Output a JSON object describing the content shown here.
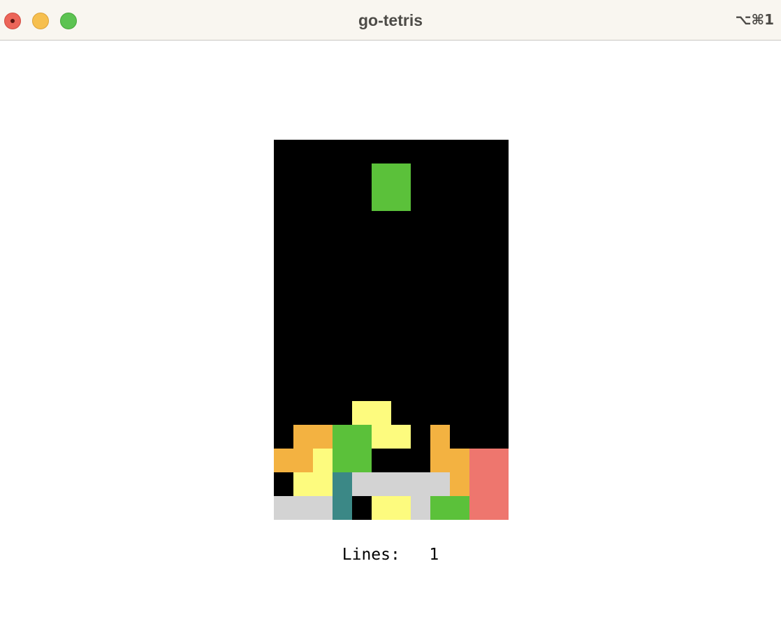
{
  "window": {
    "title": "go-tetris",
    "shortcut": "⌥⌘1"
  },
  "status": {
    "lines_label": "Lines:",
    "lines_value": "1"
  },
  "game": {
    "columns": 12,
    "rows": 16,
    "colors": {
      "G": "#5bc13a",
      "O": "#f3b241",
      "Y": "#fdfb7e",
      "T": "#3b8886",
      "W": "#d3d3d3",
      "R": "#ee766e"
    },
    "board": [
      "............",
      "............",
      "............",
      "............",
      "............",
      "............",
      "............",
      "............",
      "............",
      "............",
      "............",
      "....YY......",
      ".OOGGYY.O...",
      "OOYGG...OORR",
      ".YYTWWWWWORR",
      "WWWT.YYWGGRR"
    ],
    "falling_piece": {
      "color": "G",
      "cells": [
        [
          1,
          5
        ],
        [
          1,
          6
        ],
        [
          2,
          5
        ],
        [
          2,
          6
        ]
      ]
    }
  }
}
